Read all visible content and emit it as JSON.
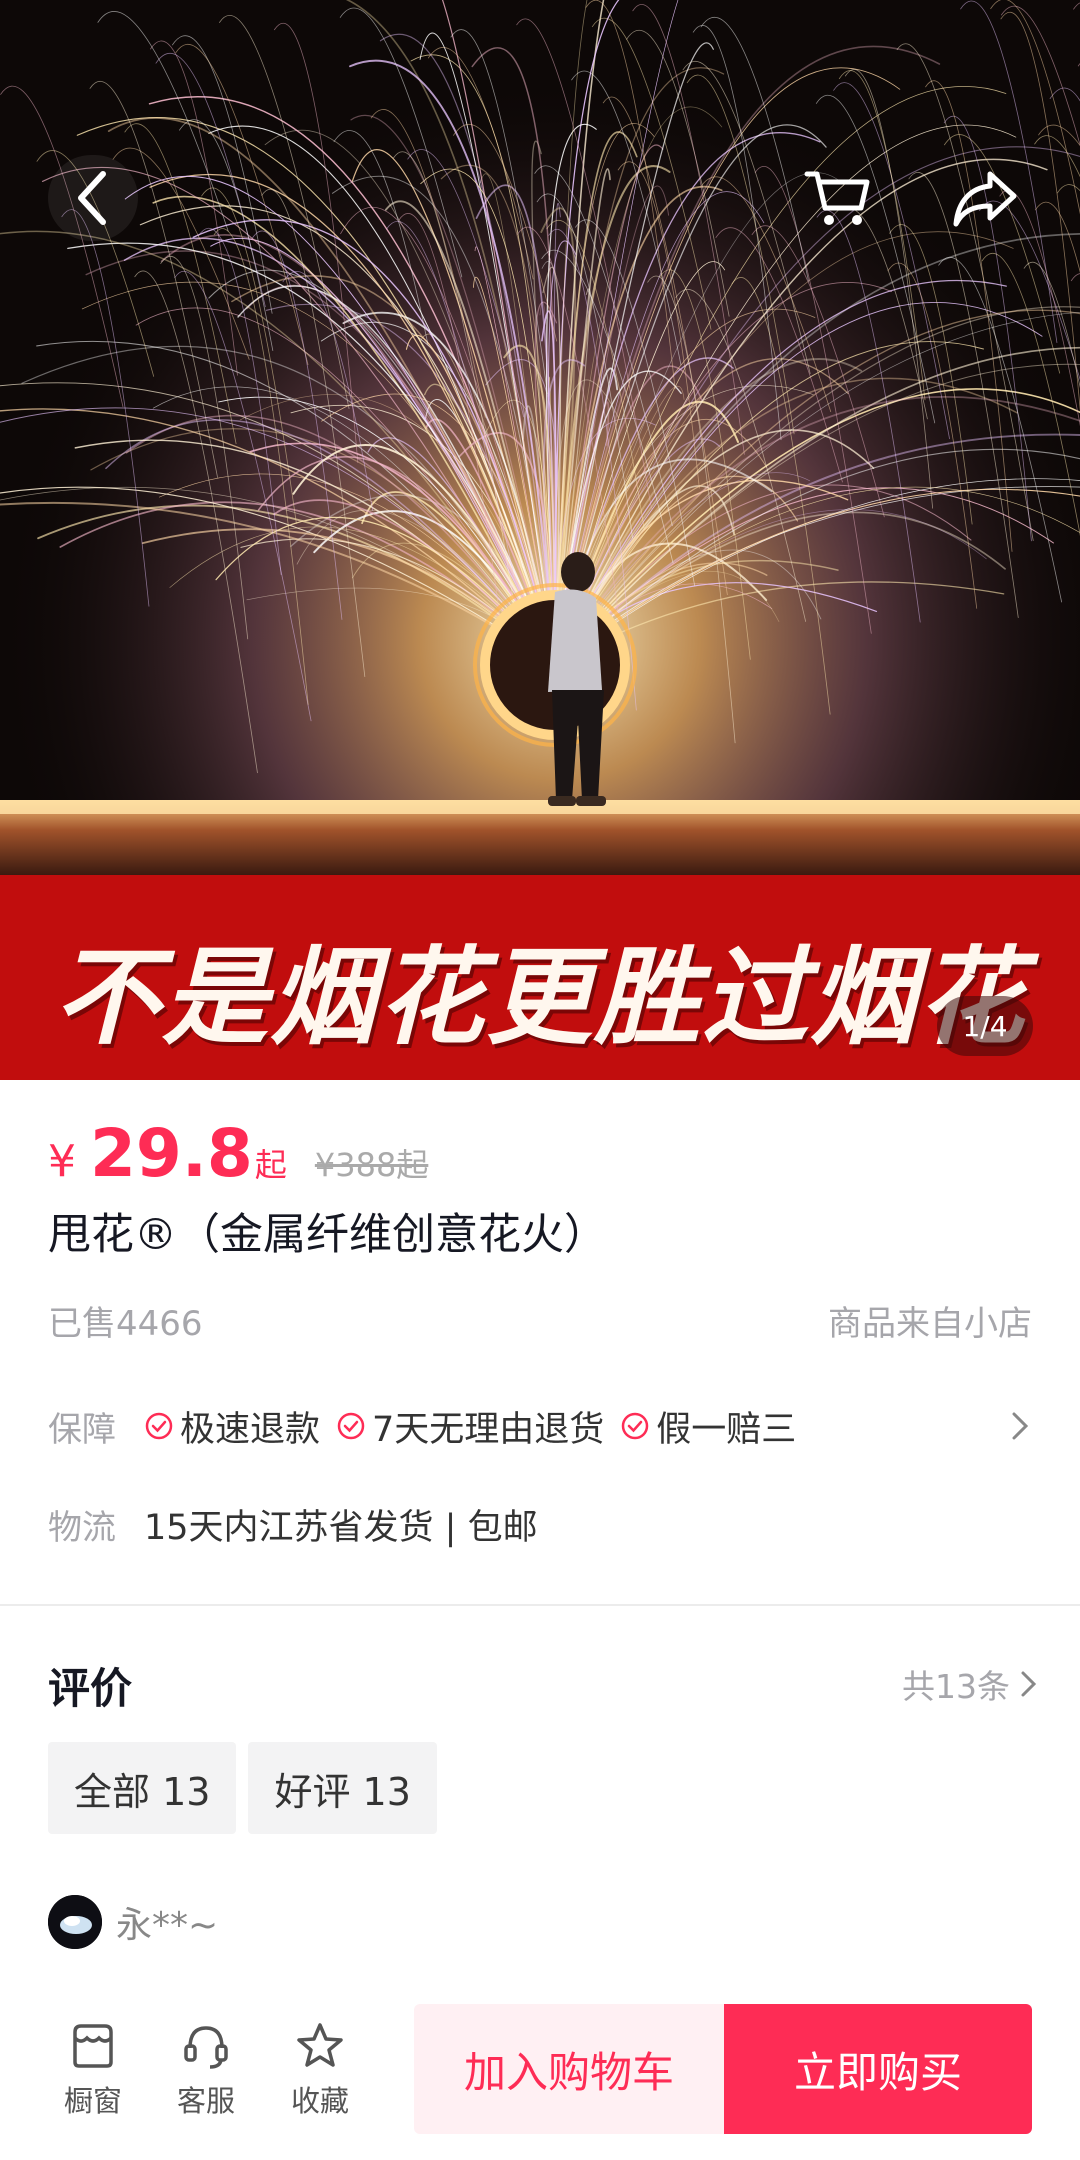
{
  "colors": {
    "accent": "#fe2c55",
    "banner": "#c10d0d",
    "muted": "#a6a6ab"
  },
  "header": {
    "back_icon": "chevron-left-icon",
    "cart_icon": "cart-icon",
    "share_icon": "share-icon"
  },
  "gallery": {
    "banner_text": "不是烟花更胜过烟花",
    "indicator": "1/4"
  },
  "product": {
    "currency": "¥",
    "price": "29.8",
    "price_suffix": "起",
    "original_price": "¥388起",
    "title": "甩花®（金属纤维创意花火）",
    "sold": "已售4466",
    "source": "商品来自小店"
  },
  "guarantee": {
    "label": "保障",
    "items": [
      "极速退款",
      "7天无理由退货",
      "假一赔三"
    ]
  },
  "logistics": {
    "label": "物流",
    "text": "15天内江苏省发货 | 包邮"
  },
  "reviews": {
    "title": "评价",
    "count": "共13条",
    "filters": [
      "全部 13",
      "好评 13"
    ],
    "first_user": "永**~"
  },
  "bottom_bar": {
    "items": [
      {
        "label": "橱窗",
        "icon": "shop-icon"
      },
      {
        "label": "客服",
        "icon": "headset-icon"
      },
      {
        "label": "收藏",
        "icon": "star-icon"
      }
    ],
    "add_to_cart": "加入购物车",
    "buy_now": "立即购买"
  }
}
